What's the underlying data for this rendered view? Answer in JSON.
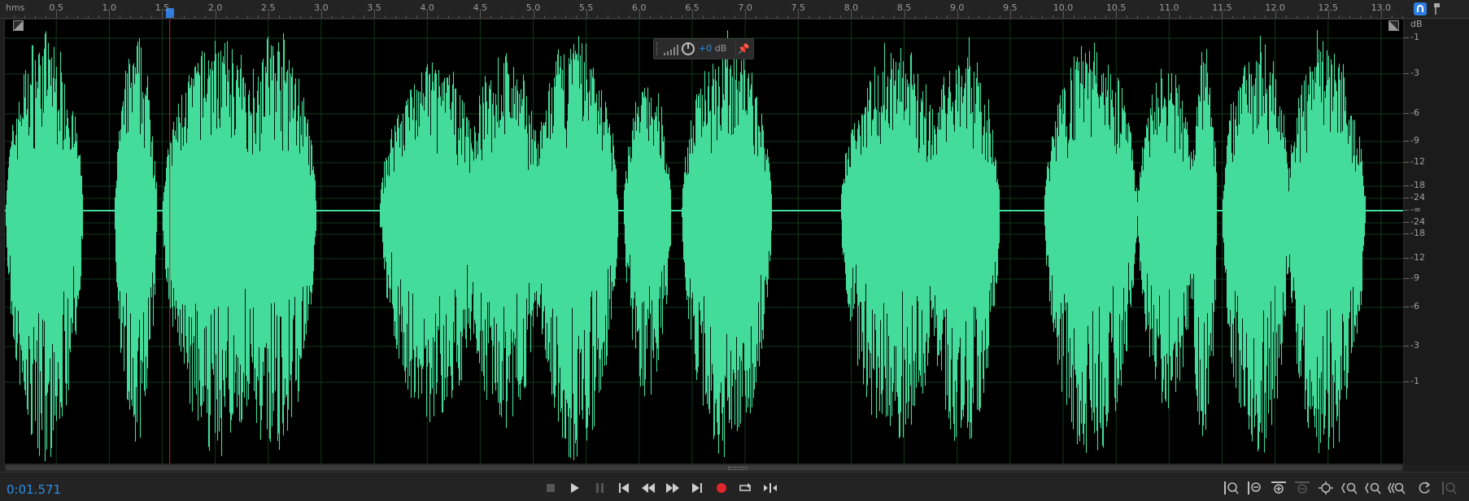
{
  "ruler": {
    "unit": "hms",
    "labels": [
      "0.5",
      "1.0",
      "1.5",
      "2.0",
      "2.5",
      "3.0",
      "3.5",
      "4.0",
      "4.5",
      "5.0",
      "5.5",
      "6.0",
      "6.5",
      "7.0",
      "7.5",
      "8.0",
      "8.5",
      "9.0",
      "9.5",
      "10.0",
      "10.5",
      "11.0",
      "11.5",
      "12.0",
      "12.5",
      "13.0"
    ]
  },
  "db_scale": {
    "unit": "dB",
    "labels": [
      "-1",
      "-3",
      "-6",
      "-9",
      "-12",
      "-18",
      "-24",
      "-∞",
      "-24",
      "-18",
      "-12",
      "-9",
      "-6",
      "-3",
      "-1"
    ]
  },
  "hud": {
    "gain_value": "+0",
    "gain_unit": "dB"
  },
  "playhead": {
    "time_seconds": 1.571
  },
  "waveform": {
    "color": "#44dc9a",
    "duration_seconds": 13.1
  },
  "colors": {
    "waveform": "#44dc9a",
    "accent": "#2f8ee8",
    "playhead": "#c62828",
    "record": "#e0262a"
  },
  "transport": {
    "current_time": "0:01.571",
    "buttons": [
      "stop-icon",
      "play-icon",
      "pause-icon",
      "go-to-start-icon",
      "rewind-icon",
      "fast-forward-icon",
      "go-to-end-icon",
      "record-icon",
      "loop-playback-icon",
      "skip-selection-icon"
    ]
  },
  "zoom_controls": [
    "zoom-in-amplitude-icon",
    "zoom-out-amplitude-icon",
    "zoom-in-time-icon",
    "zoom-out-time-icon",
    "zoom-to-selection-icon",
    "zoom-in-at-start-icon",
    "zoom-in-at-end-icon",
    "zoom-out-full-icon",
    "zoom-reset-icon",
    "zoom-fit-icon"
  ]
}
